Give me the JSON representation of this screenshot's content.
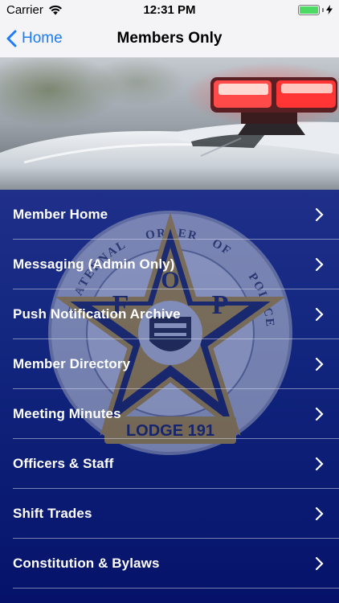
{
  "status_bar": {
    "carrier": "Carrier",
    "time": "12:31 PM",
    "icons": [
      "wifi-icon",
      "battery-icon",
      "charging-bolt-icon"
    ]
  },
  "nav": {
    "back_label": "Home",
    "title": "Members Only"
  },
  "emblem_text": {
    "lodge": "LODGE 191",
    "letters": [
      "F",
      "O",
      "P"
    ],
    "ring_words": [
      "FRATERNAL",
      "ORDER",
      "OF",
      "POLICE"
    ]
  },
  "menu": {
    "items": [
      {
        "label": "Member Home"
      },
      {
        "label": "Messaging (Admin Only)"
      },
      {
        "label": "Push Notification Archive"
      },
      {
        "label": "Member Directory"
      },
      {
        "label": "Meeting Minutes"
      },
      {
        "label": "Officers & Staff"
      },
      {
        "label": "Shift Trades"
      },
      {
        "label": "Constitution & Bylaws"
      }
    ]
  },
  "colors": {
    "accent": "#1b7cf4",
    "menu_bg_top": "#1f2f8a",
    "menu_bg_bottom": "#06126a",
    "battery": "#4cd964"
  }
}
